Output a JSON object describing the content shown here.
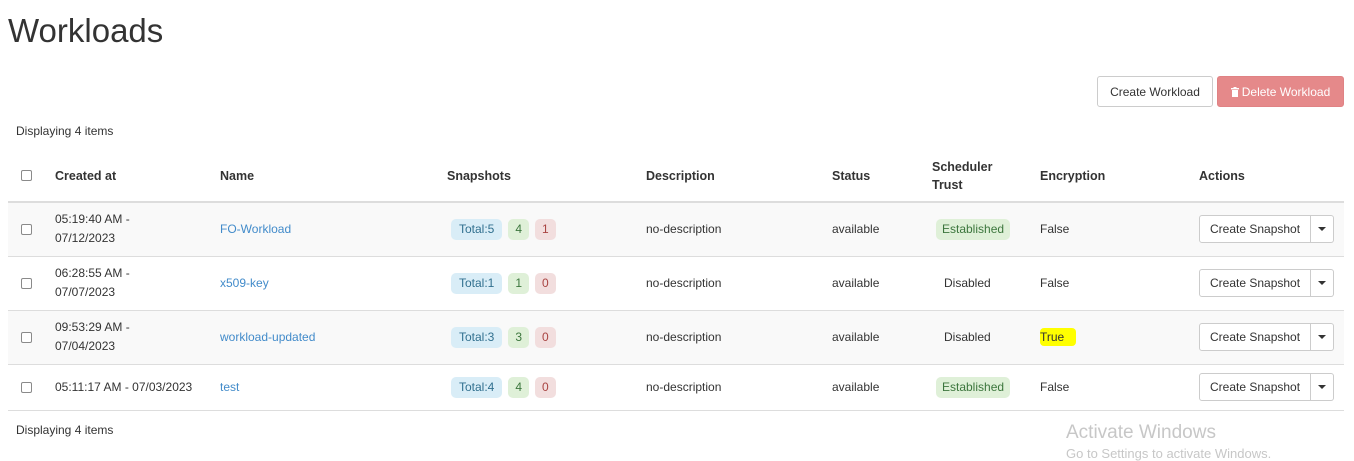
{
  "page": {
    "title": "Workloads"
  },
  "toolbar": {
    "create_label": "Create Workload",
    "delete_label": "Delete Workload",
    "delete_icon": "trash-icon"
  },
  "table": {
    "count_top": "Displaying 4 items",
    "count_bottom": "Displaying 4 items",
    "headers": {
      "created_at": "Created at",
      "name": "Name",
      "snapshots": "Snapshots",
      "description": "Description",
      "status": "Status",
      "scheduler_trust": "Scheduler Trust",
      "encryption": "Encryption",
      "actions": "Actions"
    },
    "rows": [
      {
        "created_line1": "05:19:40 AM -",
        "created_line2": "07/12/2023",
        "name": "FO-Workload",
        "snap_total": "Total:5",
        "snap_ok": "4",
        "snap_err": "1",
        "description": "no-description",
        "status": "available",
        "trust": "Established",
        "encryption": "False",
        "action": "Create Snapshot"
      },
      {
        "created_line1": "06:28:55 AM -",
        "created_line2": "07/07/2023",
        "name": "x509-key",
        "snap_total": "Total:1",
        "snap_ok": "1",
        "snap_err": "0",
        "description": "no-description",
        "status": "available",
        "trust": "Disabled",
        "encryption": "False",
        "action": "Create Snapshot"
      },
      {
        "created_line1": "09:53:29 AM -",
        "created_line2": "07/04/2023",
        "name": "workload-updated",
        "snap_total": "Total:3",
        "snap_ok": "3",
        "snap_err": "0",
        "description": "no-description",
        "status": "available",
        "trust": "Disabled",
        "encryption": "True",
        "action": "Create Snapshot"
      },
      {
        "created": "05:11:17 AM - 07/03/2023",
        "name": "test",
        "snap_total": "Total:4",
        "snap_ok": "4",
        "snap_err": "0",
        "description": "no-description",
        "status": "available",
        "trust": "Established",
        "encryption": "False",
        "action": "Create Snapshot"
      }
    ]
  },
  "watermark": {
    "title": "Activate Windows",
    "subtitle": "Go to Settings to activate Windows."
  },
  "colors": {
    "danger_button": "#e5898a",
    "link": "#428bca",
    "highlight": "#ffff00",
    "badge_total_bg": "#d9edf7",
    "badge_ok_bg": "#dff0d8",
    "badge_err_bg": "#f2dede"
  }
}
